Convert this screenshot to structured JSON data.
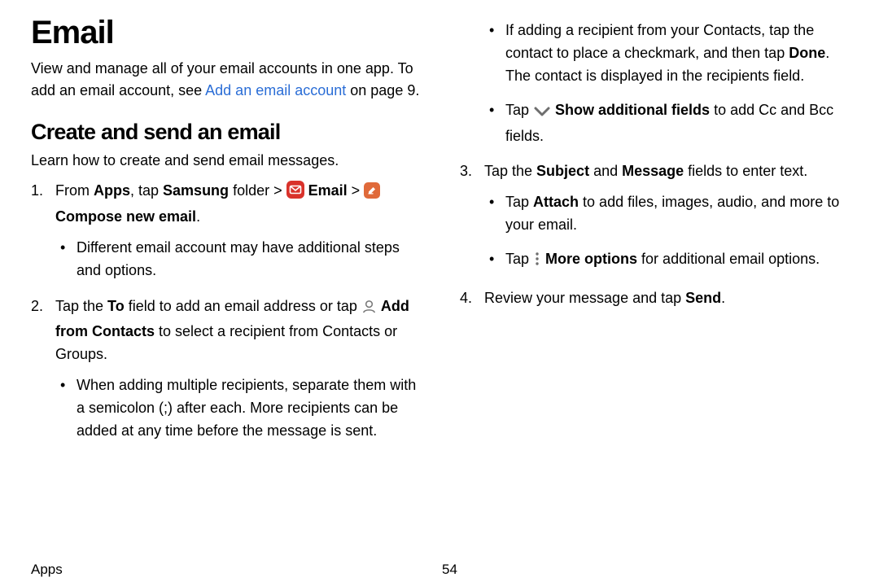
{
  "title": "Email",
  "intro_pre": "View and manage all of your email accounts in one app. To add an email account, see ",
  "intro_link": "Add an email account",
  "intro_post": " on page 9.",
  "section_heading": "Create and send an email",
  "section_sub": "Learn how to create and send email messages.",
  "steps": {
    "s1_num": "1.",
    "s1": {
      "a": "From ",
      "b": "Apps",
      "c": ", tap ",
      "d": "Samsung",
      "e": " folder > ",
      "f": "Email",
      "g": " > ",
      "h": "Compose new email",
      "i": "."
    },
    "s1_bullets": {
      "b1": "Different email account may have additional steps and options."
    },
    "s2_num": "2.",
    "s2": {
      "a": "Tap the ",
      "b": "To",
      "c": " field to add an email address or tap ",
      "d": "Add from Contacts",
      "e": " to select a recipient from Contacts or Groups."
    },
    "s2_bullets": {
      "b1": "When adding multiple recipients, separate them with a semicolon (;) after each. More recipients can be added at any time before the message is sent.",
      "b2a": "If adding a recipient from your Contacts, tap the contact to place a checkmark, and then tap ",
      "b2b": "Done",
      "b2c": ". The contact is displayed in the recipients field.",
      "b3a": "Tap ",
      "b3b": "Show additional fields",
      "b3c": " to add Cc and Bcc fields."
    },
    "s3_num": "3.",
    "s3": {
      "a": "Tap the ",
      "b": "Subject",
      "c": " and ",
      "d": "Message",
      "e": " fields to enter text."
    },
    "s3_bullets": {
      "b1a": "Tap ",
      "b1b": "Attach",
      "b1c": " to add files, images, audio, and more to your email.",
      "b2a": "Tap ",
      "b2b": "More options",
      "b2c": " for additional email options."
    },
    "s4_num": "4.",
    "s4": {
      "a": "Review your message and tap ",
      "b": "Send",
      "c": "."
    }
  },
  "footer": {
    "section": "Apps",
    "page": "54"
  }
}
